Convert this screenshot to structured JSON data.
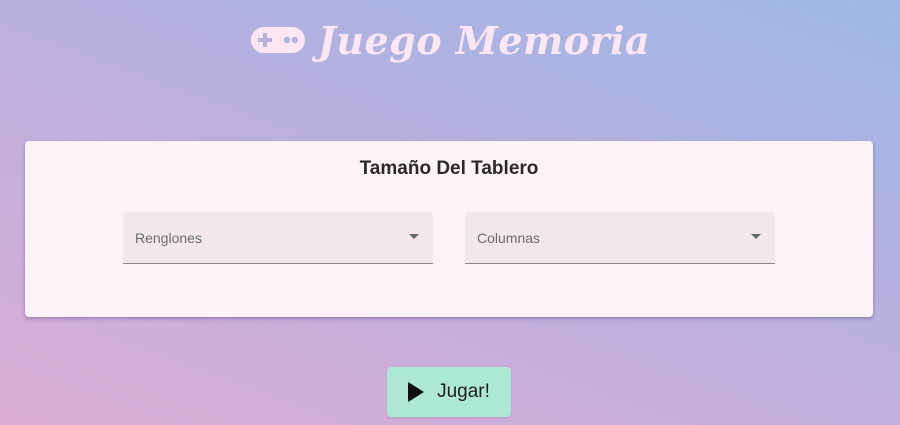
{
  "header": {
    "title": "Juego Memoria",
    "icon": "gamepad-icon"
  },
  "board_size": {
    "title": "Tamaño Del Tablero",
    "rows_select": {
      "label": "Renglones",
      "icon": "chevron-down-icon"
    },
    "cols_select": {
      "label": "Columnas",
      "icon": "chevron-down-icon"
    }
  },
  "play_button": {
    "label": "Jugar!",
    "icon": "play-icon",
    "color": "#ade8d4"
  },
  "colors": {
    "title_text": "#fbe6f3",
    "card_background": "#fdf3f7"
  }
}
